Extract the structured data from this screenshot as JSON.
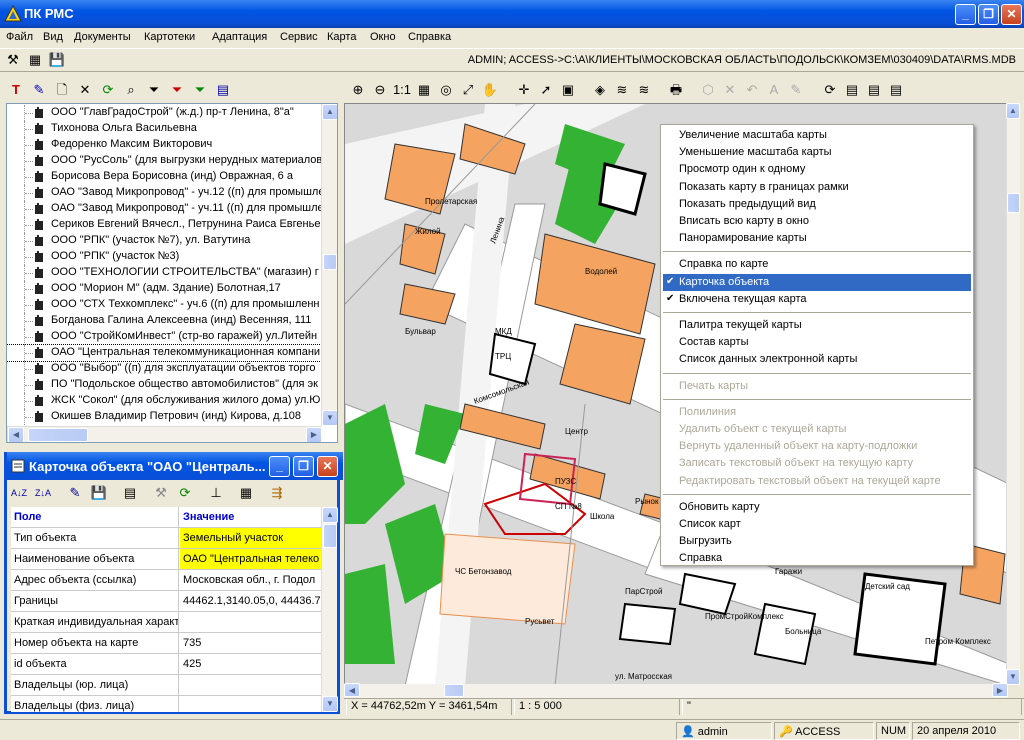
{
  "window": {
    "title": "ПК РМС",
    "minimize": "_",
    "maximize": "❐",
    "close": "✕"
  },
  "menu": [
    "Файл",
    "Вид",
    "Документы",
    "Картотеки",
    "Адаптация",
    "Сервис",
    "Карта",
    "Окно",
    "Справка"
  ],
  "path": "ADMIN; ACCESS->C:\\А\\КЛИЕНТЫ\\МОСКОВСКАЯ ОБЛАСТЬ\\ПОДОЛЬСК\\КОМЗЕМ\\030409\\DATA\\RMS.MDB",
  "main_toolbar": [
    "tools-icon",
    "table-icon",
    "floppy-icon"
  ],
  "left_toolbar": [
    "T",
    "✎",
    "🗋",
    "✕",
    "⟳",
    "⌕",
    "⏷",
    "⏷",
    "⏷",
    "▤"
  ],
  "tree": [
    "ООО \"ГлавГрадоСтрой\" (ж.д.) пр-т Ленина, 8\"а\"",
    "Тихонова Ольга Васильевна",
    "Федоренко Максим Викторович",
    "ООО \"РусСоль\" (для выгрузки нерудных материалов",
    "Борисова Вера Борисовна (инд) Овражная, 6 а",
    "ОАО \"Завод Микропровод\" - уч.12 ((п) для промышле",
    "ОАО \"Завод Микропровод\" - уч.11 ((п) для промышле",
    "Сериков Евгений Вячесл., Петрунина Раиса Евгенье",
    "ООО \"РПК\" (участок №7), ул. Ватутина",
    "ООО \"РПК\" (участок №3)",
    "ООО \"ТЕХНОЛОГИИ СТРОИТЕЛЬСТВА\" (магазин) г",
    "ООО \"Морион М\" (адм. Здание) Болотная,17",
    "ООО \"СТХ Техкомплекс\" - уч.6 ((п) для промышленн",
    "Богданова Галина Алексеевна (инд) Весенняя, 111",
    "ООО \"СтройКомИнвест\" (стр-во гаражей) ул.Литейн",
    "ОАО \"Центральная телекоммуникационная компани",
    "ООО \"Выбор\" ((п) для эксплуатации объектов торго",
    "ПО \"Подольское общество автомобилистов\" (для эк",
    "ЖСК \"Сокол\" (для обслуживания жилого дома) ул.Ю",
    "Окишев Владимир Петрович (инд) Кирова, д.108"
  ],
  "card": {
    "title": "Карточка объекта \"ОАО \"Централь...",
    "toolbar": [
      "A↓Z",
      "Z↓A",
      "✎",
      "💾",
      "▤",
      "⚒",
      "⟳",
      "⊥",
      "▦",
      "⇶"
    ],
    "header_field": "Поле",
    "header_value": "Значение",
    "rows": [
      {
        "field": "Тип объекта",
        "value": "Земельный участок"
      },
      {
        "field": "Наименование объекта",
        "value": "ОАО \"Центральная телеко"
      },
      {
        "field": "Адрес объекта (ссылка)",
        "value": "Московская обл., г. Подол"
      },
      {
        "field": "Границы",
        "value": "44462.1,3140.05,0, 44436.7"
      },
      {
        "field": "Краткая индивидуальная характ",
        "value": ""
      },
      {
        "field": "Номер объекта на карте",
        "value": "735"
      },
      {
        "field": "id объекта",
        "value": "425"
      },
      {
        "field": "Владельцы (юр. лица)",
        "value": ""
      },
      {
        "field": "Владельцы (физ. лица)",
        "value": ""
      }
    ],
    "highlight": "#ffff00"
  },
  "map_toolbar": [
    "⊕",
    "⊖",
    "1:1",
    "▦",
    "◎",
    "⤢",
    "✋",
    "✛",
    "➚",
    "▣",
    "◈",
    "≋",
    "≋",
    "🖶",
    "⬡",
    "✕",
    "↶",
    "A",
    "✎",
    "⟳",
    "▤",
    "▤",
    "▤"
  ],
  "map_labels": [
    "Пролетарская",
    "Ленина",
    "Комсомольская",
    "ул. Матросская",
    "Бульвар",
    "ПУЗС",
    "Центр",
    "ЧС Бетонзавод",
    "СП №8",
    "Школа",
    "ТРЦ",
    "Жилой",
    "Русьвет",
    "ПромСтройКомплекс",
    "Детский сад",
    "Гаражи",
    "МКД",
    "ПарСтрой",
    "Водолей",
    "Рынок",
    "Петром Комплекс",
    "Больница"
  ],
  "ctx_menu": [
    {
      "label": "Увеличение масштаба карты",
      "state": "normal"
    },
    {
      "label": "Уменьшение масштаба карты",
      "state": "normal"
    },
    {
      "label": "Просмотр один к одному",
      "state": "normal"
    },
    {
      "label": "Показать карту в границах рамки",
      "state": "normal"
    },
    {
      "label": "Показать предыдущий вид",
      "state": "normal"
    },
    {
      "label": "Вписать всю карту в окно",
      "state": "normal"
    },
    {
      "label": "Панорамирование карты",
      "state": "normal"
    },
    {
      "sep": true
    },
    {
      "label": "Справка по карте",
      "state": "normal"
    },
    {
      "label": "Карточка объекта",
      "state": "selected",
      "check": "✔"
    },
    {
      "label": "Включена текущая карта",
      "state": "normal",
      "check": "✔"
    },
    {
      "sep": true
    },
    {
      "label": "Палитра  текущей карты",
      "state": "normal"
    },
    {
      "label": "Состав карты",
      "state": "normal"
    },
    {
      "label": "Список данных электронной карты",
      "state": "normal"
    },
    {
      "sep": true
    },
    {
      "label": "Печать карты",
      "state": "disabled"
    },
    {
      "sep": true
    },
    {
      "label": "Полилиния",
      "state": "disabled"
    },
    {
      "label": "Удалить объект с текущей карты",
      "state": "disabled"
    },
    {
      "label": "Вернуть удаленный объект на карту-подложки",
      "state": "disabled"
    },
    {
      "label": "Записать текстовый объект на  текущую карту",
      "state": "disabled"
    },
    {
      "label": "Редактировать текстовый объект на текущей карте",
      "state": "disabled"
    },
    {
      "sep": true
    },
    {
      "label": "Обновить карту",
      "state": "normal"
    },
    {
      "label": "Список карт",
      "state": "normal"
    },
    {
      "label": "Выгрузить",
      "state": "normal"
    },
    {
      "label": "Справка",
      "state": "normal"
    }
  ],
  "map_status": {
    "coords": "X = 44762,52m  Y = 3461,54m",
    "scale": "1 : 5 000",
    "extra": "\""
  },
  "status": {
    "user": "admin",
    "db": "ACCESS",
    "num": "NUM",
    "date": "20 апреля 2010"
  },
  "colors": {
    "building": "#f4a460",
    "green": "#33b233",
    "road": "#ffffff",
    "selected": "#316ac5"
  }
}
